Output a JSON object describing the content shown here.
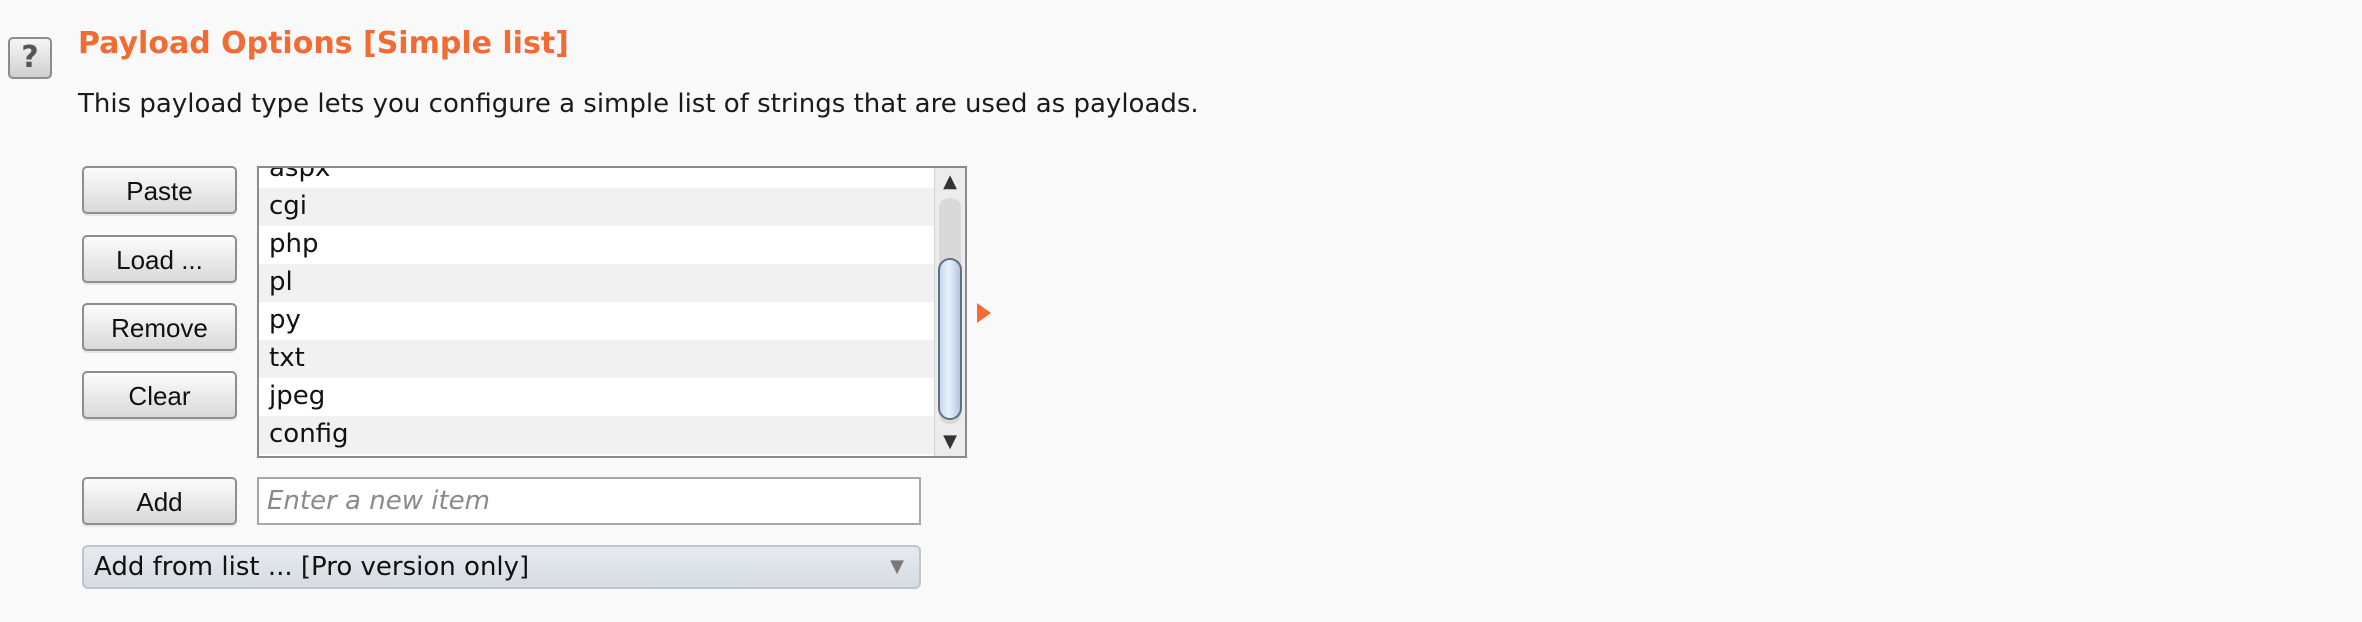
{
  "section": {
    "help_icon": "?",
    "title": "Payload Options [Simple list]",
    "description": "This payload type lets you configure a simple list of strings that are used as payloads."
  },
  "buttons": {
    "paste": "Paste",
    "load": "Load ...",
    "remove": "Remove",
    "clear": "Clear",
    "add": "Add"
  },
  "list": {
    "items": [
      "aspx",
      "cgi",
      "php",
      "pl",
      "py",
      "txt",
      "jpeg",
      "config"
    ]
  },
  "scrollbar": {
    "up_arrow": "▲",
    "down_arrow": "▼"
  },
  "input": {
    "placeholder": "Enter a new item",
    "value": ""
  },
  "dropdown": {
    "selected": "Add from list ... [Pro version only]",
    "arrow": "▼"
  },
  "colors": {
    "accent": "#f26b32",
    "background": "#f9f9f9"
  }
}
